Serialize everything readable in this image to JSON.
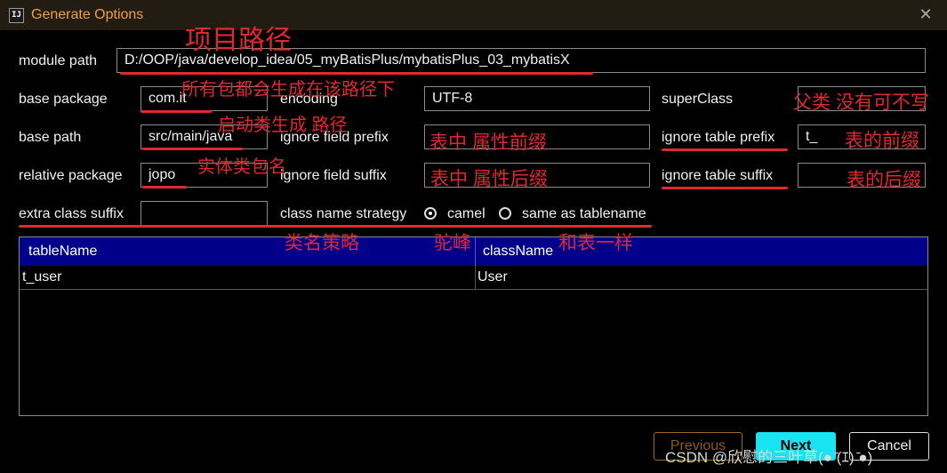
{
  "window": {
    "title": "Generate Options",
    "app_icon": "IJ"
  },
  "form": {
    "module_path": {
      "label": "module path",
      "value": "D:/OOP/java/develop_idea/05_myBatisPlus/mybatisPlus_03_mybatisX"
    },
    "base_package": {
      "label": "base package",
      "value": "com.it"
    },
    "encoding": {
      "label": "encoding",
      "value": "UTF-8"
    },
    "super_class": {
      "label": "superClass",
      "value": ""
    },
    "base_path": {
      "label": "base path",
      "value": "src/main/java"
    },
    "ignore_field_prefix": {
      "label": "ignore field prefix",
      "value": ""
    },
    "ignore_table_prefix": {
      "label": "ignore table prefix",
      "value": "t_"
    },
    "relative_package": {
      "label": "relative package",
      "value": "jopo"
    },
    "ignore_field_suffix": {
      "label": "ignore field suffix",
      "value": ""
    },
    "ignore_table_suffix": {
      "label": "ignore table suffix",
      "value": ""
    },
    "extra_class_suffix": {
      "label": "extra class suffix",
      "value": ""
    },
    "class_name_strategy": {
      "label": "class name strategy",
      "options": [
        {
          "label": "camel",
          "selected": true
        },
        {
          "label": "same as tablename",
          "selected": false
        }
      ]
    }
  },
  "table": {
    "columns": [
      "tableName",
      "className"
    ],
    "rows": [
      {
        "tableName": "t_user",
        "className": "User"
      }
    ]
  },
  "buttons": {
    "previous": "Previous",
    "next": "Next",
    "cancel": "Cancel"
  },
  "annotations": {
    "project_path": "项目路径",
    "all_packages": "所有包都会生成在该路径下",
    "parent_class": "父类 没有可不写",
    "startup_class": "启动类生成 路径",
    "field_prefix": "表中 属性前缀",
    "table_prefix": "表的前缀",
    "entity_package": "实体类包名",
    "field_suffix": "表中 属性后缀",
    "table_suffix": "表的后缀",
    "class_name_strategy": "类名策略",
    "camel": "驼峰",
    "same_as_table": "和表一样"
  },
  "watermark": "CSDN @欣慰的三叶草(● ̄(ｴ) ̄●)",
  "colors": {
    "title_text": "#f0a040",
    "table_header": "#00008b",
    "next_button": "#19e3f0",
    "annotation": "#e0282f"
  }
}
